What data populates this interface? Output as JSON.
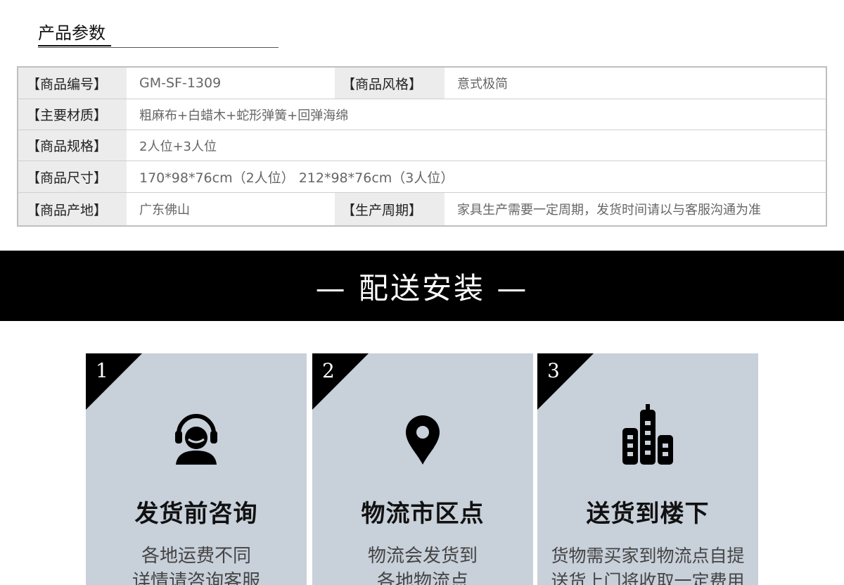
{
  "section_title": "产品参数",
  "params": {
    "row1": {
      "label": "【商品编号】",
      "value": "GM-SF-1309",
      "label2": "【商品风格】",
      "value2": "意式极简"
    },
    "row2": {
      "label": "【主要材质】",
      "value": "粗麻布+白蜡木+蛇形弹簧+回弹海绵"
    },
    "row3": {
      "label": "【商品规格】",
      "value": "2人位+3人位"
    },
    "row4": {
      "label": "【商品尺寸】",
      "value": "170*98*76cm（2人位） 212*98*76cm（3人位）"
    },
    "row5": {
      "label": "【商品产地】",
      "value": "广东佛山",
      "label2": "【生产周期】",
      "value2": "家具生产需要一定周期，发货时间请以与客服沟通为准"
    }
  },
  "banner_title": "— 配送安装 —",
  "cards": [
    {
      "num": "1",
      "icon": "headset-icon",
      "title": "发货前咨询",
      "desc": "各地运费不同\n详情请咨询客服"
    },
    {
      "num": "2",
      "icon": "map-pin-icon",
      "title": "物流市区点",
      "desc": "物流会发货到\n各地物流点"
    },
    {
      "num": "3",
      "icon": "buildings-icon",
      "title": "送货到楼下",
      "desc": "货物需买家到物流点自提\n送货上门将收取一定费用"
    }
  ]
}
